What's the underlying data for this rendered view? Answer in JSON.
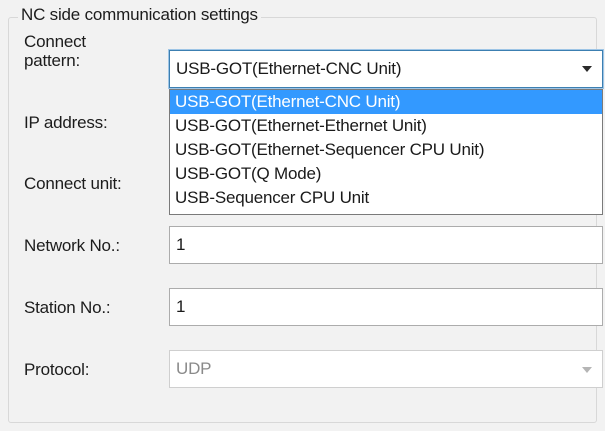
{
  "group_title": "NC side communication settings",
  "labels": {
    "connect_pattern": "Connect\npattern:",
    "connect_pattern_line1": "Connect",
    "connect_pattern_line2": "pattern:",
    "ip_address": "IP address:",
    "connect_unit": "Connect unit:",
    "network_no": "Network No.:",
    "station_no": "Station No.:",
    "protocol": "Protocol:"
  },
  "connect_pattern_select": {
    "selected": "USB-GOT(Ethernet-CNC Unit)",
    "options": [
      "USB-GOT(Ethernet-CNC Unit)",
      "USB-GOT(Ethernet-Ethernet Unit)",
      "USB-GOT(Ethernet-Sequencer CPU Unit)",
      "USB-GOT(Q Mode)",
      "USB-Sequencer CPU Unit"
    ],
    "highlighted_index": 0
  },
  "fields": {
    "network_no": "1",
    "station_no": "1",
    "protocol": "UDP"
  },
  "colors": {
    "background": "#f2f2f2",
    "selection": "#3399ff",
    "disabled_text": "#8a8a8a"
  },
  "icons": {
    "combo_arrow": "chevron-down-icon",
    "protocol_arrow": "chevron-down-icon"
  }
}
